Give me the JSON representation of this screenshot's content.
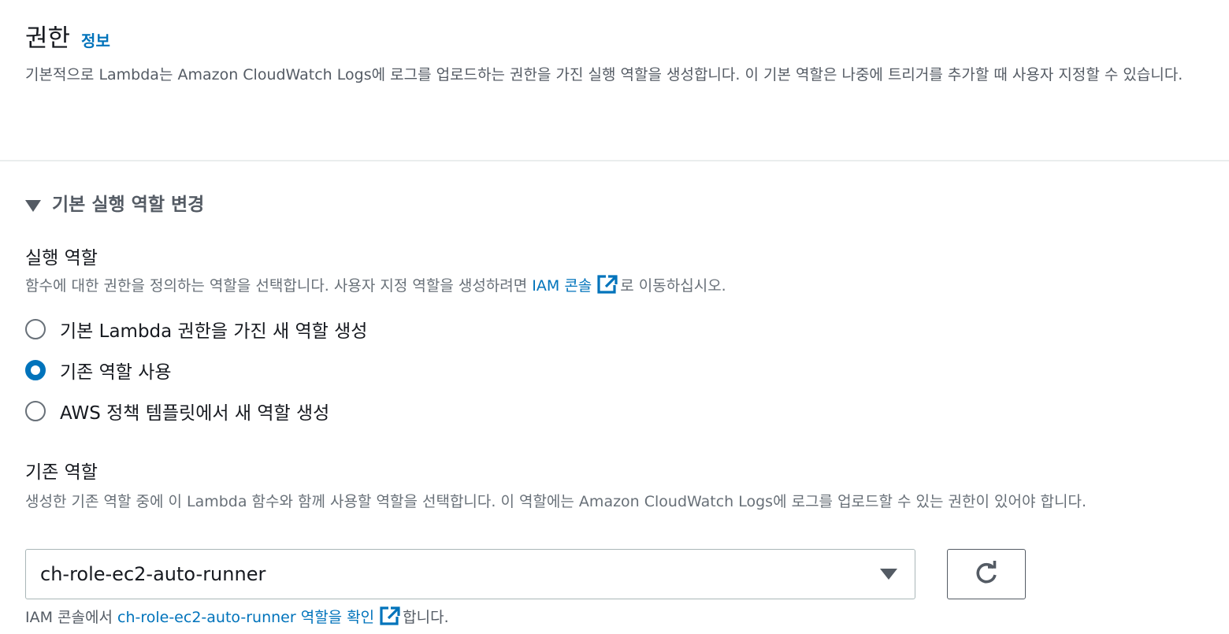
{
  "header": {
    "title": "권한",
    "info_link": "정보",
    "description": "기본적으로 Lambda는 Amazon CloudWatch Logs에 로그를 업로드하는 권한을 가진 실행 역할을 생성합니다. 이 기본 역할은 나중에 트리거를 추가할 때 사용자 지정할 수 있습니다."
  },
  "expander": {
    "label": "기본 실행 역할 변경"
  },
  "execution_role": {
    "label": "실행 역할",
    "desc_before": "함수에 대한 권한을 정의하는 역할을 선택합니다. 사용자 지정 역할을 생성하려면 ",
    "desc_link": "IAM 콘솔",
    "desc_after": "로 이동하십시오.",
    "options": [
      {
        "label": "기본 Lambda 권한을 가진 새 역할 생성",
        "checked": false
      },
      {
        "label": "기존 역할 사용",
        "checked": true
      },
      {
        "label": "AWS 정책 템플릿에서 새 역할 생성",
        "checked": false
      }
    ]
  },
  "existing_role": {
    "label": "기존 역할",
    "description": "생성한 기존 역할 중에 이 Lambda 함수와 함께 사용할 역할을 선택합니다. 이 역할에는 Amazon CloudWatch Logs에 로그를 업로드할 수 있는 권한이 있어야 합니다.",
    "selected_value": "ch-role-ec2-auto-runner",
    "footer_before": "IAM 콘솔에서 ",
    "footer_link": "ch-role-ec2-auto-runner 역할을 확인",
    "footer_after": "합니다."
  },
  "colors": {
    "link": "#0073bb",
    "text": "#16191f",
    "secondary_text": "#545b64"
  },
  "icons": {
    "external_link": "external-link-icon",
    "refresh": "refresh-icon",
    "caret": "caret-down-icon"
  }
}
